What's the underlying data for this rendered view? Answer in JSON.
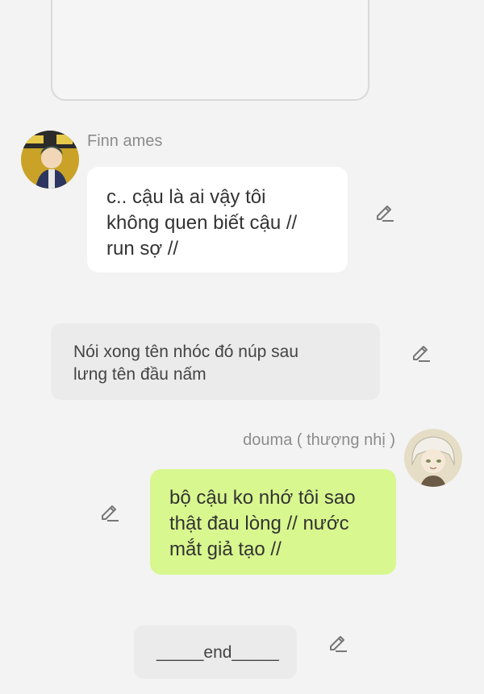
{
  "messages": [
    {
      "sender": "Finn ames",
      "text": "c.. cậu là ai vậy tôi\nkhông quen biết cậu //\nrun sợ //",
      "side": "left"
    },
    {
      "type": "narration",
      "text": "Nói xong tên nhóc đó núp sau\nlưng tên đầu nấm"
    },
    {
      "sender": "douma ( thượng nhị )",
      "text": "bộ cậu ko nhớ tôi sao\nthật đau lòng // nước\nmắt giả tạo //",
      "side": "right"
    },
    {
      "type": "narration",
      "text": "_____end_____"
    }
  ],
  "colors": {
    "background": "#f3f3f3",
    "incoming_bubble": "#ffffff",
    "outgoing_bubble": "#d8f78f",
    "narration_box": "#ebebeb",
    "sender_name": "#8c8c8c"
  },
  "icons": {
    "edit": "pencil-icon",
    "avatar_left": "finn-avatar",
    "avatar_right": "douma-avatar"
  }
}
